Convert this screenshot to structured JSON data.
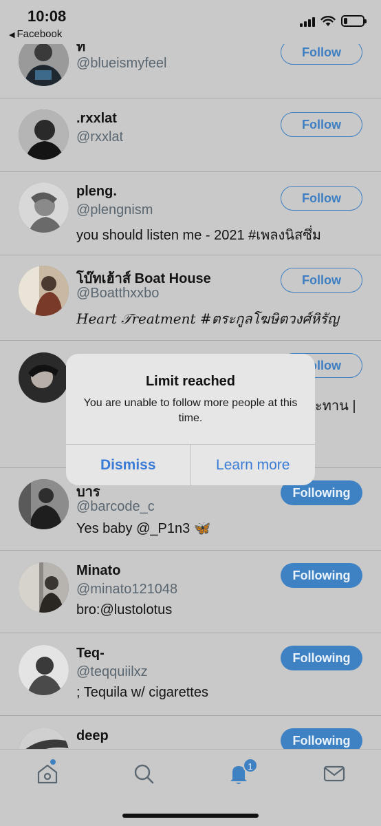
{
  "status_bar": {
    "time": "10:08",
    "back_app": "Facebook",
    "back_glyph": "◀",
    "battery_level": 0.2
  },
  "accounts": [
    {
      "name": "ท",
      "handle": "@blueismyfeel",
      "bio": "",
      "button": "Follow",
      "state": "follow"
    },
    {
      "name": ".rxxlat",
      "handle": "@rxxlat",
      "bio": "",
      "button": "Follow",
      "state": "follow"
    },
    {
      "name": "pleng.",
      "handle": "@plengnism",
      "bio": "you should listen me - 2021 #เพลงนิสซึ่ม",
      "button": "Follow",
      "state": "follow"
    },
    {
      "name": "โบ๊ทเฮ้าส์ Boat House",
      "handle": "@Boatthxxbo",
      "bio": "𝐻𝑒𝑎𝑟𝑡 𝒯𝑟𝑒𝑎𝑡𝑚𝑒𝑛𝑡 #ตระกูลโฆษิตวงศ์หิรัญ",
      "button": "Follow",
      "state": "follow"
    },
    {
      "name": "",
      "handle": "",
      "bio": "ะทาน |",
      "button": "Follow",
      "state": "follow"
    },
    {
      "name": "บาร",
      "handle": "@barcode_c",
      "bio": "Yes baby @_P1n3",
      "bio_emoji": "🦋",
      "button": "Following",
      "state": "following"
    },
    {
      "name": "Minato",
      "handle": "@minato121048",
      "bio": "bro:@lustolotus",
      "button": "Following",
      "state": "following"
    },
    {
      "name": "Teq-",
      "handle": "@teqquiilxz",
      "bio": "; Tequila w/ cigarettes",
      "button": "Following",
      "state": "following"
    },
    {
      "name": "deep",
      "handle": "",
      "bio": "",
      "button": "Following",
      "state": "following"
    }
  ],
  "alert": {
    "title": "Limit reached",
    "message": "You are unable to follow more people at this time.",
    "dismiss": "Dismiss",
    "learn_more": "Learn more"
  },
  "tab_bar": {
    "tabs": [
      "home-icon",
      "search-icon",
      "notifications-icon",
      "messages-icon"
    ],
    "notifications_badge": "1"
  },
  "colors": {
    "accent": "#3f82c4",
    "background": "#c9c9c9",
    "alert_background": "#e6e6e6",
    "alert_button": "#3a7bd5"
  }
}
